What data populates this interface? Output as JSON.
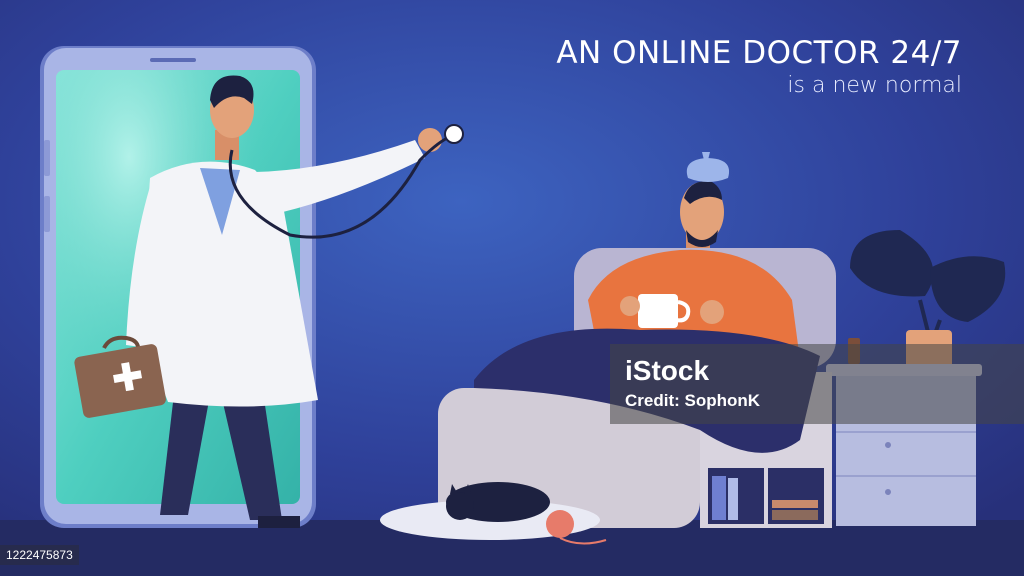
{
  "headline": {
    "title": "AN ONLINE DOCTOR 24/7",
    "subtitle": "is a new normal"
  },
  "watermark": {
    "logo": "iStock",
    "credit": "Credit: SophonK"
  },
  "image_id": "1222475873",
  "colors": {
    "background": "#2c3a8f",
    "phone_screen": "#5fd6c5",
    "coat": "#f3f4f8",
    "sweater": "#e8743f",
    "blanket": "#2c2f6b",
    "floor": "#242b63"
  },
  "icons": [
    "doctor",
    "stethoscope",
    "medical-bag",
    "phone",
    "sick-man",
    "mug",
    "ice-pack",
    "bed",
    "cat",
    "yarn-ball",
    "plant",
    "nightstand"
  ]
}
